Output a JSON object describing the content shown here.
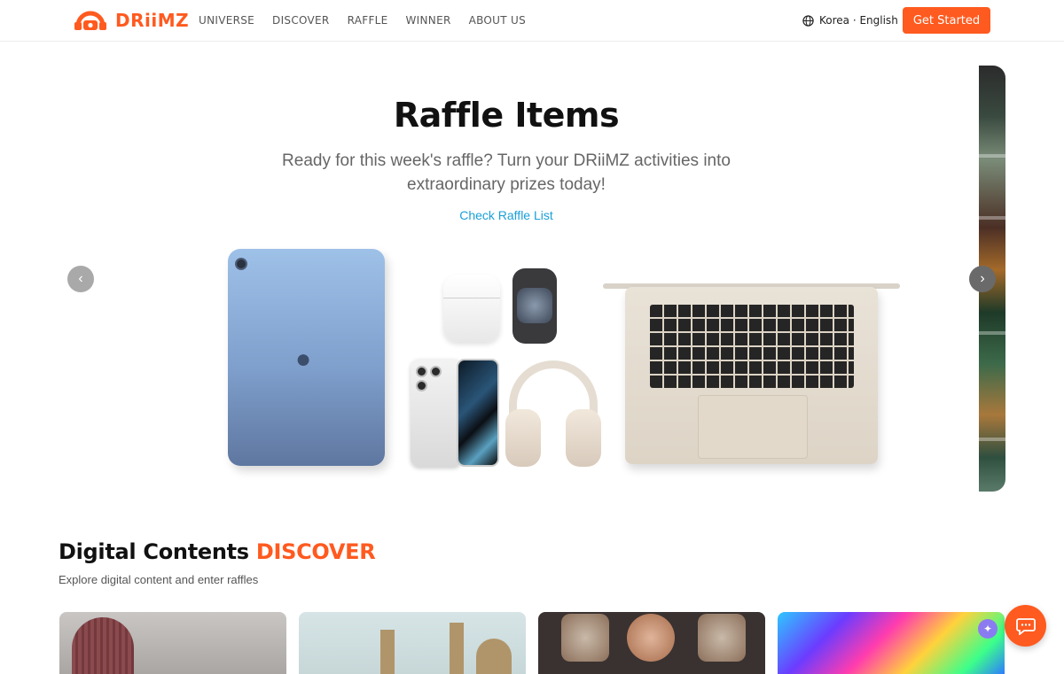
{
  "header": {
    "brand": "DRiiMZ",
    "nav": [
      "UNIVERSE",
      "DISCOVER",
      "RAFFLE",
      "WINNER",
      "ABOUT US"
    ],
    "language": "Korea · English",
    "cta_label": "Get Started"
  },
  "hero": {
    "title": "Raffle Items",
    "subtitle": "Ready for this week's raffle? Turn your DRiiMZ activities into extraordinary prizes today!",
    "link_label": "Check Raffle List",
    "prev_glyph": "‹",
    "next_glyph": "›",
    "products": [
      "iPad",
      "AirPods Pro",
      "Apple Watch",
      "iPhone",
      "AirPods Max",
      "MacBook Air"
    ]
  },
  "discover": {
    "title_prefix": "Digital Contents",
    "title_accent": "DISCOVER",
    "subtitle": "Explore digital content and enter raffles"
  },
  "colors": {
    "accent": "#ff5a1f",
    "link": "#1aa0d8"
  },
  "icons": [
    "logo-icon",
    "globe-icon",
    "chevron-left-icon",
    "chevron-right-icon",
    "sparkle-icon",
    "chat-icon"
  ]
}
